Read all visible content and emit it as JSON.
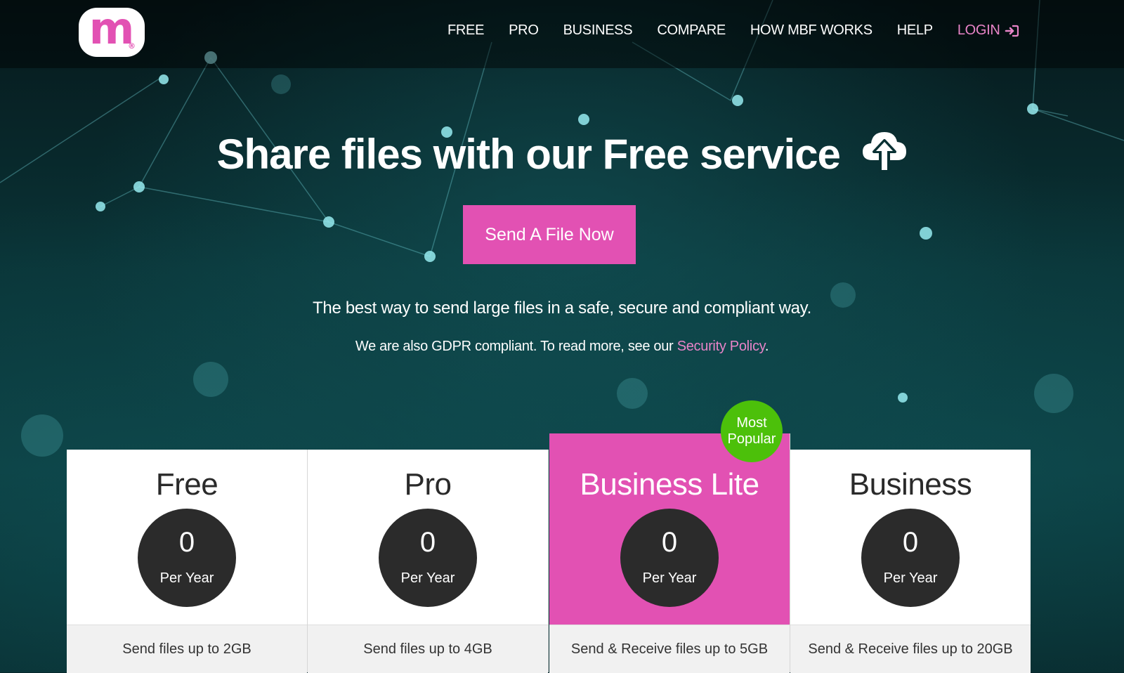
{
  "brand": {
    "logo_letter": "m",
    "logo_reg": "®",
    "accent_color": "#e251b3",
    "badge_color": "#4cc00a"
  },
  "nav": {
    "items": [
      {
        "label": "FREE"
      },
      {
        "label": "PRO"
      },
      {
        "label": "BUSINESS"
      },
      {
        "label": "COMPARE"
      },
      {
        "label": "HOW MBF WORKS"
      },
      {
        "label": "HELP"
      }
    ],
    "login_label": "LOGIN",
    "login_icon": "sign-in-icon"
  },
  "hero": {
    "title": "Share files with our Free service",
    "title_icon": "cloud-upload-icon",
    "cta_label": "Send A File Now",
    "tagline": "The best way to send large files in a safe, secure and compliant way.",
    "gdpr_text": "We are also GDPR compliant. To read more, see our ",
    "gdpr_link": "Security Policy",
    "gdpr_end": "."
  },
  "badge": {
    "line1": "Most",
    "line2": "Popular"
  },
  "plans": [
    {
      "name": "Free",
      "price": "0",
      "period": "Per Year",
      "feature": "Send files up to 2GB"
    },
    {
      "name": "Pro",
      "price": "0",
      "period": "Per Year",
      "feature": "Send files up to 4GB"
    },
    {
      "name": "Business Lite",
      "price": "0",
      "period": "Per Year",
      "feature": "Send & Receive files up to 5GB"
    },
    {
      "name": "Business",
      "price": "0",
      "period": "Per Year",
      "feature": "Send & Receive files up to 20GB"
    }
  ]
}
